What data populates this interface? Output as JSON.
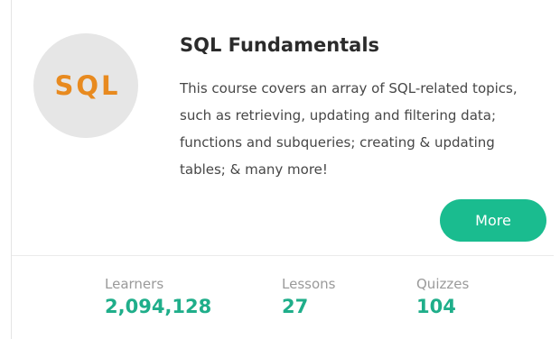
{
  "course": {
    "logo_text": "SQL",
    "title": "SQL Fundamentals",
    "description": "This course covers an array of SQL-related topics, such as retrieving, updating and filtering data; functions and subqueries; creating & updating tables; & many more!",
    "more_label": "More"
  },
  "stats": [
    {
      "label": "Learners",
      "value": "2,094,128"
    },
    {
      "label": "Lessons",
      "value": "27"
    },
    {
      "label": "Quizzes",
      "value": "104"
    }
  ],
  "colors": {
    "accent": "#1abc8f",
    "logo": "#e88a1f",
    "logo_background": "#e6e6e6",
    "stat_value": "#1fae8a"
  }
}
